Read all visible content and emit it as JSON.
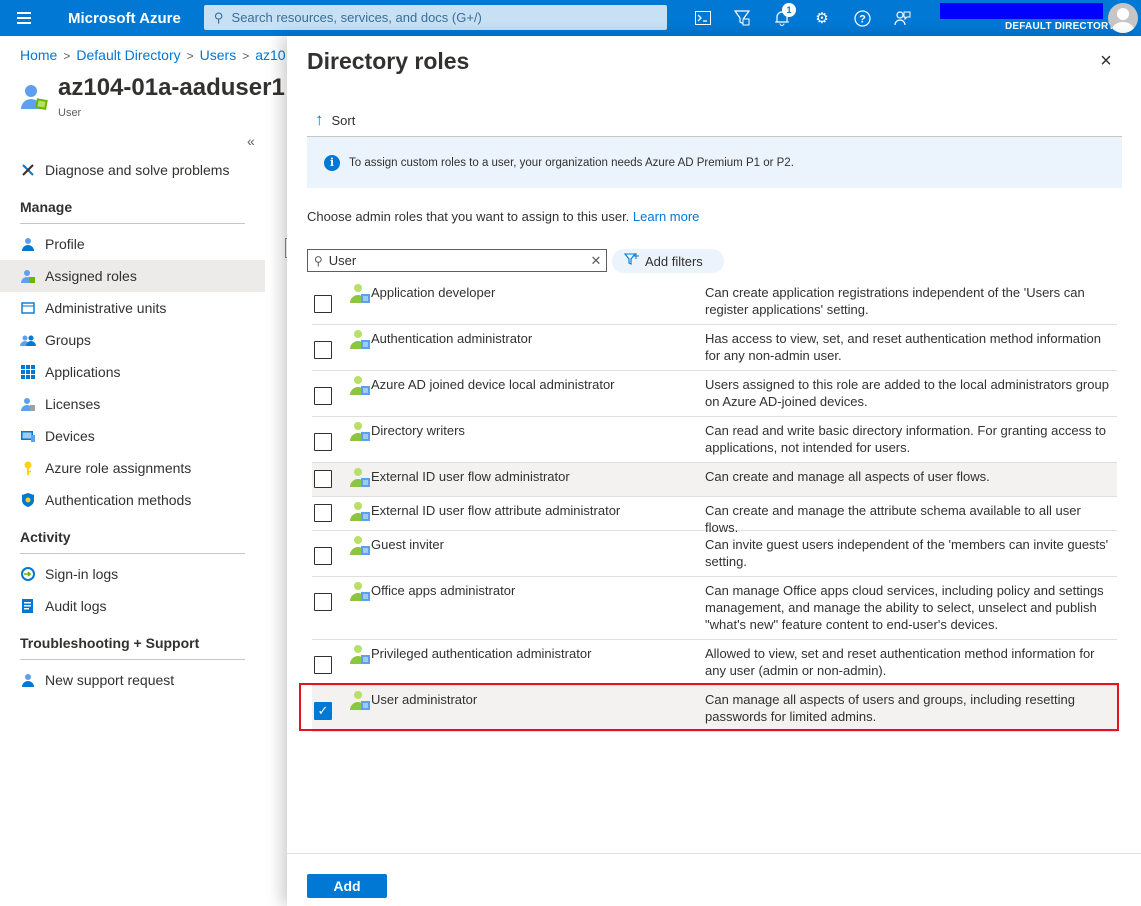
{
  "topbar": {
    "brand": "Microsoft Azure",
    "search_placeholder": "Search resources, services, and docs (G+/)",
    "notification_count": "1",
    "directory_label": "DEFAULT DIRECTORY",
    "icons": [
      "cloud-shell-icon",
      "directory-filter-icon",
      "notifications-icon",
      "settings-icon",
      "help-icon",
      "feedback-icon"
    ]
  },
  "breadcrumb": {
    "items": [
      "Home",
      "Default Directory",
      "Users",
      "az10"
    ]
  },
  "page": {
    "title": "az104-01a-aaduser1 |",
    "subtitle": "User",
    "collapse_glyph": "«"
  },
  "nav": {
    "top_items": [
      {
        "label": "Diagnose and solve problems",
        "icon": "wrench-icon"
      }
    ],
    "manage_header": "Manage",
    "manage_items": [
      {
        "label": "Profile",
        "icon": "profile-icon"
      },
      {
        "label": "Assigned roles",
        "icon": "assigned-roles-icon",
        "selected": true
      },
      {
        "label": "Administrative units",
        "icon": "admin-units-icon"
      },
      {
        "label": "Groups",
        "icon": "groups-icon"
      },
      {
        "label": "Applications",
        "icon": "applications-icon"
      },
      {
        "label": "Licenses",
        "icon": "licenses-icon"
      },
      {
        "label": "Devices",
        "icon": "devices-icon"
      },
      {
        "label": "Azure role assignments",
        "icon": "key-icon"
      },
      {
        "label": "Authentication methods",
        "icon": "shield-icon"
      }
    ],
    "activity_header": "Activity",
    "activity_items": [
      {
        "label": "Sign-in logs",
        "icon": "sign-in-icon"
      },
      {
        "label": "Audit logs",
        "icon": "audit-icon"
      }
    ],
    "support_header": "Troubleshooting + Support",
    "support_items": [
      {
        "label": "New support request",
        "icon": "support-icon"
      }
    ]
  },
  "panel": {
    "title": "Directory roles",
    "close_glyph": "×",
    "sort_label": "Sort",
    "info_text": "To assign custom roles to a user, your organization needs Azure AD Premium P1 or P2.",
    "choose_text": "Choose admin roles that you want to assign to this user.",
    "learn_more": "Learn more",
    "filter_value": "User",
    "add_filters_label": "Add filters",
    "add_button": "Add",
    "colors": {
      "accent": "#0078d4",
      "selection_outline": "#e81123"
    }
  },
  "roles": [
    {
      "name": "Application developer",
      "desc": "Can create application registrations independent of the 'Users can register applications' setting.",
      "checked": false
    },
    {
      "name": "Authentication administrator",
      "desc": "Has access to view, set, and reset authentication method information for any non-admin user.",
      "checked": false
    },
    {
      "name": "Azure AD joined device local administrator",
      "desc": "Users assigned to this role are added to the local administrators group on Azure AD-joined devices.",
      "checked": false
    },
    {
      "name": "Directory writers",
      "desc": "Can read and write basic directory information. For granting access to applications, not intended for users.",
      "checked": false
    },
    {
      "name": "External ID user flow administrator",
      "desc": "Can create and manage all aspects of user flows.",
      "checked": false,
      "hover": true
    },
    {
      "name": "External ID user flow attribute administrator",
      "desc": "Can create and manage the attribute schema available to all user flows.",
      "checked": false
    },
    {
      "name": "Guest inviter",
      "desc": "Can invite guest users independent of the 'members can invite guests' setting.",
      "checked": false
    },
    {
      "name": "Office apps administrator",
      "desc": "Can manage Office apps cloud services, including policy and settings management, and manage the ability to select, unselect and publish \"what's new\" feature content to end-user's devices.",
      "checked": false
    },
    {
      "name": "Privileged authentication administrator",
      "desc": "Allowed to view, set and reset authentication method information for any user (admin or non-admin).",
      "checked": false
    },
    {
      "name": "User administrator",
      "desc": "Can manage all aspects of users and groups, including resetting passwords for limited admins.",
      "checked": true,
      "hover": true
    }
  ]
}
